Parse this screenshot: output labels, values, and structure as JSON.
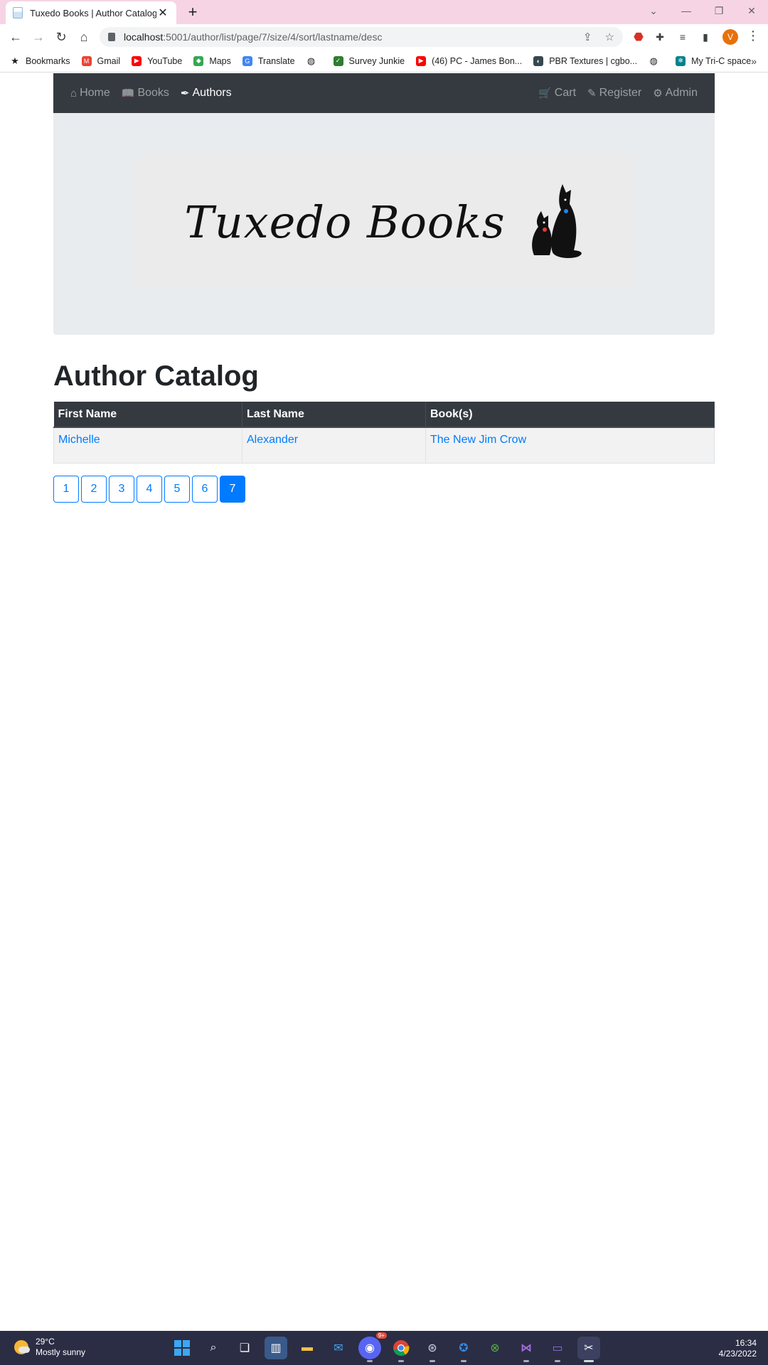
{
  "browser": {
    "tab_title": "Tuxedo Books | Author Catalog",
    "tab_close": "✕",
    "new_tab": "+",
    "url_host": "localhost",
    "url_path": ":5001/author/list/page/7/size/4/sort/lastname/desc",
    "profile_initial": "V",
    "bookmarks": [
      {
        "label": "Bookmarks",
        "icon": "star-icon",
        "color": "#202124"
      },
      {
        "label": "Gmail",
        "icon": "gmail-icon",
        "color": "#ea4335"
      },
      {
        "label": "YouTube",
        "icon": "youtube-icon",
        "color": "#ff0000"
      },
      {
        "label": "Maps",
        "icon": "maps-icon",
        "color": "#34a853"
      },
      {
        "label": "Translate",
        "icon": "translate-icon",
        "color": "#4285f4"
      },
      {
        "label": "",
        "icon": "globe-icon",
        "color": "#202124"
      },
      {
        "label": "Survey Junkie",
        "icon": "check-icon",
        "color": "#2e7d32"
      },
      {
        "label": "(46) PC - James Bon...",
        "icon": "youtube-icon",
        "color": "#ff0000"
      },
      {
        "label": "PBR Textures | cgbo...",
        "icon": "palette-icon",
        "color": "#37474f"
      },
      {
        "label": "",
        "icon": "globe-icon",
        "color": "#202124"
      },
      {
        "label": "My Tri-C space",
        "icon": "snowflake-icon",
        "color": "#00838f"
      }
    ],
    "bookmarks_more": "»"
  },
  "nav": {
    "home": "Home",
    "books": "Books",
    "authors": "Authors",
    "cart": "Cart",
    "register": "Register",
    "admin": "Admin"
  },
  "logo": {
    "text": "Tuxedo Books"
  },
  "page": {
    "heading": "Author Catalog"
  },
  "table": {
    "headers": [
      "First Name",
      "Last Name",
      "Book(s)"
    ],
    "rows": [
      [
        "Michelle",
        "Alexander",
        "The New Jim Crow"
      ]
    ]
  },
  "pagination": {
    "pages": [
      "1",
      "2",
      "3",
      "4",
      "5",
      "6",
      "7"
    ],
    "active": "7"
  },
  "taskbar": {
    "temp": "29°C",
    "weather": "Mostly sunny",
    "time": "16:34",
    "date": "4/23/2022",
    "discord_badge": "9+"
  },
  "colors": {
    "navbar": "#343a40",
    "jumbotron": "#e9ecef",
    "link": "#007bff",
    "tabstrip": "#f7d4e4",
    "taskbar": "#2b2d44"
  }
}
